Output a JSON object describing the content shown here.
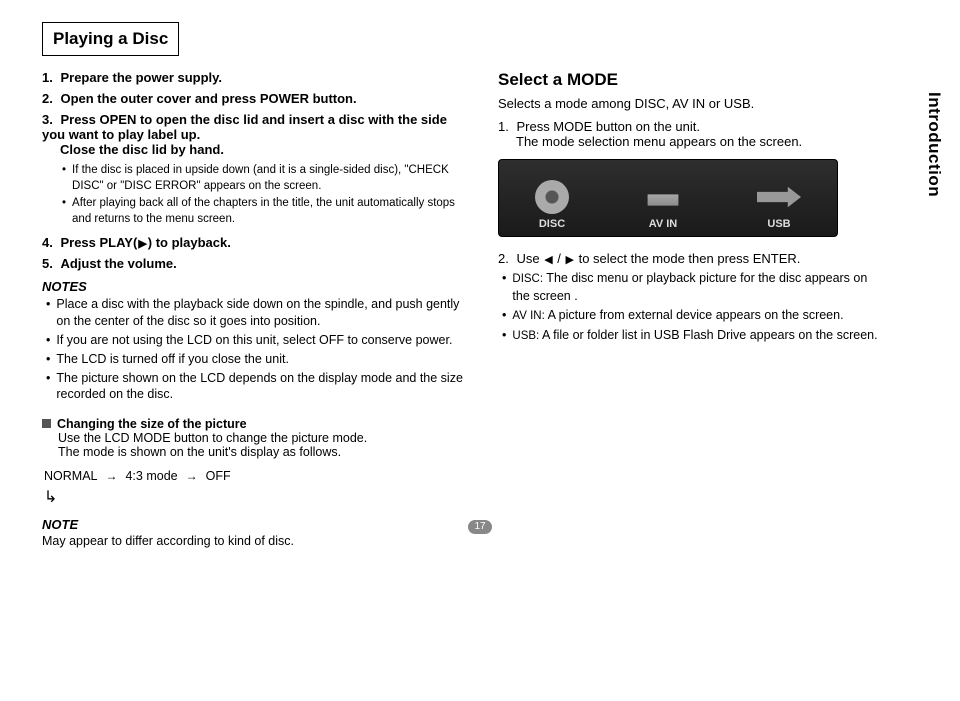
{
  "title": "Playing a Disc",
  "sideTab": "Introduction",
  "pageNum": "17",
  "left": {
    "s1": {
      "num": "1.",
      "txt": "Prepare the power supply."
    },
    "s2": {
      "num": "2.",
      "txt": "Open the outer cover and press POWER button."
    },
    "s3": {
      "num": "3.",
      "txt": "Press OPEN to open the disc lid and insert a disc with the side you want to play label up.",
      "close": "Close the disc lid by hand."
    },
    "s3bullets": [
      "If the disc is placed in upside down (and it is a single-sided disc), \"CHECK DISC\" or \"DISC ERROR\" appears on the screen.",
      "After playing back all of the chapters in the title, the unit automatically stops and returns to the menu screen."
    ],
    "s4": {
      "num": "4.",
      "pre": "Press PLAY(",
      "post": ") to playback."
    },
    "s5": {
      "num": "5.",
      "txt": "Adjust the volume."
    },
    "notesHdr": "NOTES",
    "notes": [
      "Place a disc with the playback side down on the spindle, and push gently on the center of the disc so it goes into position.",
      "If you are not using the LCD on this unit, select OFF to conserve power.",
      "The LCD is turned off if you close the unit.",
      "The picture shown on the LCD depends on the display mode and the size recorded on the disc."
    ],
    "sq": {
      "title": "Changing the size of the picture",
      "l1": "Use the LCD MODE button to change the picture mode.",
      "l2": "The mode is shown on the unit's display as follows."
    },
    "flow": {
      "a": "NORMAL",
      "b": "4:3 mode",
      "c": "OFF"
    },
    "noteHdr": "NOTE",
    "noteText": "May appear to differ according to kind of disc."
  },
  "right": {
    "h1": "Select a MODE",
    "sub": "Selects a mode among DISC, AV IN or USB.",
    "s1": {
      "num": "1.",
      "l1": "Press MODE button on the unit.",
      "l2": "The mode selection menu appears on the screen."
    },
    "modes": {
      "a": "DISC",
      "b": "AV IN",
      "c": "USB"
    },
    "s2": {
      "num": "2.",
      "pre": "Use ",
      "mid": " / ",
      "post": " to select the mode then press ENTER."
    },
    "bullets": {
      "disc": {
        "tag": "DISC:",
        "txt": " The disc menu or playback picture for the disc appears on the screen ."
      },
      "avin": {
        "tag": "AV IN:",
        "txt": " A picture from external device appears on the screen."
      },
      "usb": {
        "tag": "USB:",
        "txt": " A file or folder list in USB Flash Drive appears on the screen."
      }
    }
  }
}
